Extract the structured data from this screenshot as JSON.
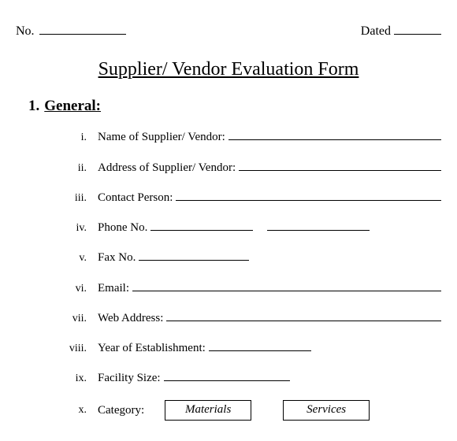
{
  "header": {
    "no_label": "No.",
    "dated_label": "Dated"
  },
  "title": "Supplier/ Vendor Evaluation Form",
  "section": {
    "number": "1.",
    "heading": "General:"
  },
  "fields": [
    {
      "roman": "i.",
      "label": "Name of Supplier/ Vendor:"
    },
    {
      "roman": "ii.",
      "label": "Address of Supplier/ Vendor:"
    },
    {
      "roman": "iii.",
      "label": "Contact Person:"
    },
    {
      "roman": "iv.",
      "label": "Phone No."
    },
    {
      "roman": "v.",
      "label": "Fax No."
    },
    {
      "roman": "vi.",
      "label": "Email:"
    },
    {
      "roman": "vii.",
      "label": "Web Address:"
    },
    {
      "roman": "viii.",
      "label": "Year of Establishment:"
    },
    {
      "roman": "ix.",
      "label": "Facility Size:"
    },
    {
      "roman": "x.",
      "label": "Category:"
    }
  ],
  "category_options": {
    "materials": "Materials",
    "services": "Services"
  }
}
